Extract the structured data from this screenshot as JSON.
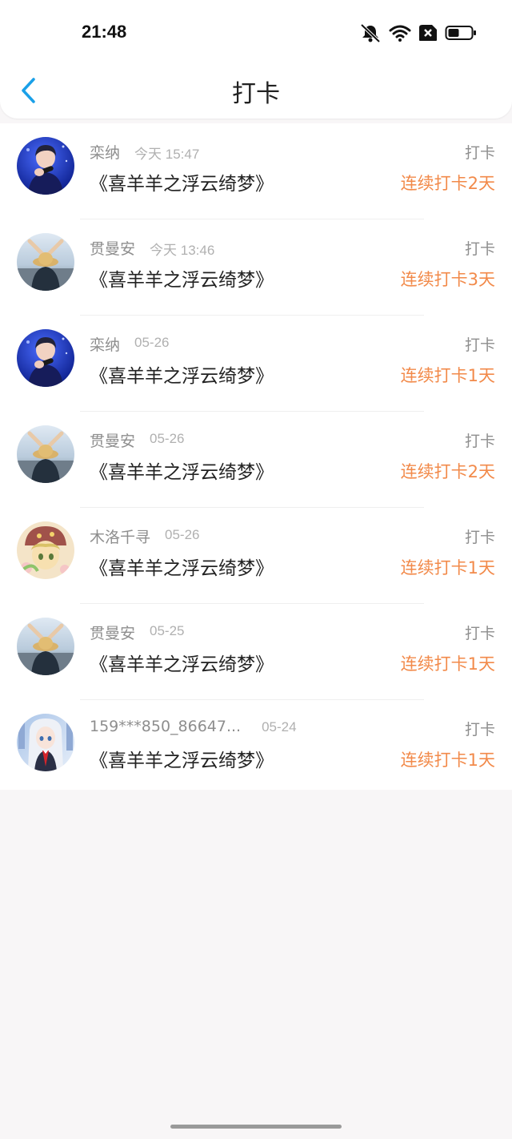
{
  "status_bar": {
    "time": "21:48"
  },
  "header": {
    "title": "打卡"
  },
  "colors": {
    "accent": "#1aa0e8",
    "streak": "#f28a4a"
  },
  "entries": [
    {
      "name": "栾纳",
      "time": "今天 15:47",
      "work": "《喜羊羊之浮云绮梦》",
      "type": "打卡",
      "streak": "连续打卡2天",
      "avatar": "singer"
    },
    {
      "name": "贯曼安",
      "time": "今天 13:46",
      "work": "《喜羊羊之浮云绮梦》",
      "type": "打卡",
      "streak": "连续打卡3天",
      "avatar": "hat-person"
    },
    {
      "name": "栾纳",
      "time": "05-26",
      "work": "《喜羊羊之浮云绮梦》",
      "type": "打卡",
      "streak": "连续打卡1天",
      "avatar": "singer"
    },
    {
      "name": "贯曼安",
      "time": "05-26",
      "work": "《喜羊羊之浮云绮梦》",
      "type": "打卡",
      "streak": "连续打卡2天",
      "avatar": "hat-person"
    },
    {
      "name": "木洛千寻",
      "time": "05-26",
      "work": "《喜羊羊之浮云绮梦》",
      "type": "打卡",
      "streak": "连续打卡1天",
      "avatar": "anime-girl"
    },
    {
      "name": "贯曼安",
      "time": "05-25",
      "work": "《喜羊羊之浮云绮梦》",
      "type": "打卡",
      "streak": "连续打卡1天",
      "avatar": "hat-person"
    },
    {
      "name": "159***850_86647...",
      "time": "05-24",
      "work": "《喜羊羊之浮云绮梦》",
      "type": "打卡",
      "streak": "连续打卡1天",
      "avatar": "silver-hair-girl"
    }
  ]
}
